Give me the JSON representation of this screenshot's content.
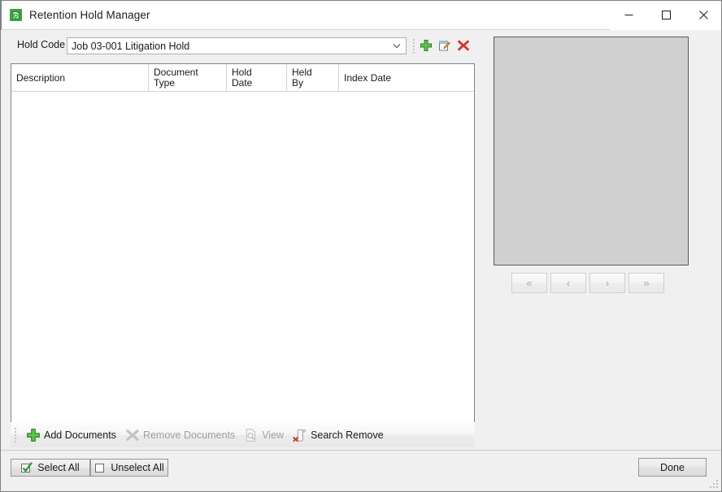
{
  "window": {
    "title": "Retention Hold Manager",
    "app_icon": "retention-hold-icon",
    "controls": {
      "minimize": "minimize-icon",
      "maximize": "maximize-icon",
      "close": "close-icon"
    }
  },
  "hold_code": {
    "label": "Hold Code",
    "value": "Job 03-001 Litigation Hold",
    "placeholder": "",
    "dropdown_icon": "chevron-down-icon",
    "tools": [
      {
        "name": "add-hold-code",
        "icon": "green-plus-icon",
        "tooltip": "Add"
      },
      {
        "name": "edit-hold-code",
        "icon": "edit-pencil-icon",
        "tooltip": "Edit"
      },
      {
        "name": "delete-hold-code",
        "icon": "red-x-icon",
        "tooltip": "Delete"
      }
    ]
  },
  "grid": {
    "columns": [
      "Description",
      "Document\nType",
      "Hold\nDate",
      "Held\nBy",
      "Index Date"
    ],
    "rows": []
  },
  "toolbar": {
    "items": [
      {
        "label": "Add Documents",
        "icon": "green-plus-icon",
        "enabled": true
      },
      {
        "label": "Remove Documents",
        "icon": "grey-x-icon",
        "enabled": false
      },
      {
        "label": "View",
        "icon": "page-magnifier-icon",
        "enabled": false
      },
      {
        "label": "Search Remove",
        "icon": "scroll-red-x-icon",
        "enabled": true
      }
    ]
  },
  "preview": {
    "navigation": [
      {
        "label": "«",
        "name": "first-page-button"
      },
      {
        "label": "‹",
        "name": "previous-page-button"
      },
      {
        "label": "›",
        "name": "next-page-button"
      },
      {
        "label": "»",
        "name": "last-page-button"
      }
    ]
  },
  "footer": {
    "select_all": "Select All",
    "unselect_all": "Unselect All",
    "done": "Done"
  }
}
